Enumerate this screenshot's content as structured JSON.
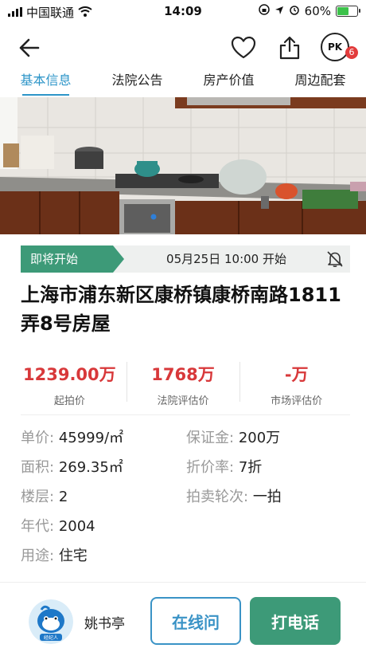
{
  "status_bar": {
    "carrier": "中国联通",
    "time": "14:09",
    "battery": "60%"
  },
  "nav": {
    "pk_label": "PK",
    "pk_badge": "6"
  },
  "tabs": [
    {
      "label": "基本信息",
      "active": true
    },
    {
      "label": "法院公告",
      "active": false
    },
    {
      "label": "房产价值",
      "active": false
    },
    {
      "label": "周边配套",
      "active": false
    }
  ],
  "auction": {
    "tag": "即将开始",
    "start_time": "05月25日 10:00  开始"
  },
  "title": "上海市浦东新区康桥镇康桥南路1811弄8号房屋",
  "prices": [
    {
      "value": "1239.00万",
      "label": "起拍价"
    },
    {
      "value": "1768万",
      "label": "法院评估价"
    },
    {
      "value": "-万",
      "label": "市场评估价"
    }
  ],
  "details": {
    "unit_price": {
      "key": "单价:",
      "value": "45999/㎡"
    },
    "deposit": {
      "key": "保证金:",
      "value": "200万"
    },
    "area": {
      "key": "面积:",
      "value": "269.35㎡"
    },
    "discount": {
      "key": "折价率:",
      "value": "7折"
    },
    "floor": {
      "key": "楼层:",
      "value": "2"
    },
    "round": {
      "key": "拍卖轮次:",
      "value": "一拍"
    },
    "year": {
      "key": "年代:",
      "value": "2004"
    },
    "usage": {
      "key": "用途:",
      "value": "住宅"
    }
  },
  "agent": {
    "name": "姚书亭",
    "badge": "经纪人"
  },
  "actions": {
    "online": "在线问",
    "call": "打电话"
  },
  "colors": {
    "accent_blue": "#2d95c8",
    "accent_green": "#3d9a78",
    "price_red": "#d8383a"
  }
}
